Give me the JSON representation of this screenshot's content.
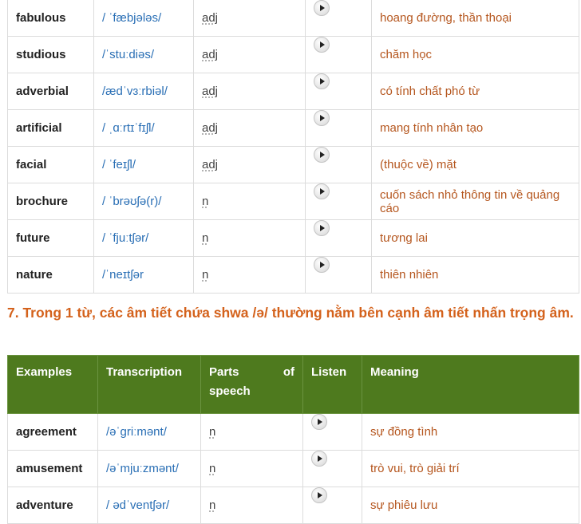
{
  "table1": {
    "rows": [
      {
        "word": "fabulous",
        "transcription": "/ ˈfæbjələs/",
        "pos": "adj",
        "meaning": "hoang đường, thần thoại"
      },
      {
        "word": "studious",
        "transcription": "/ˈstuːdiəs/",
        "pos": "adj",
        "meaning": "chăm học"
      },
      {
        "word": "adverbial",
        "transcription": "/ædˈvɜːrbiəl/",
        "pos": "adj",
        "meaning": "có tính chất phó từ"
      },
      {
        "word": "artificial",
        "transcription": "/ ˌɑːrtɪˈfɪʃl/",
        "pos": "adj",
        "meaning": "mang tính nhân tạo"
      },
      {
        "word": "facial",
        "transcription": "/ ˈfeɪʃl/",
        "pos": "adj",
        "meaning": "(thuộc về) mặt"
      },
      {
        "word": "brochure",
        "transcription": "/ ˈbrəʊʃə(r)/",
        "pos": "n",
        "meaning": "cuốn sách nhỏ thông tin về quảng cáo"
      },
      {
        "word": "future",
        "transcription": "/ ˈfjuːtʃər/",
        "pos": "n",
        "meaning": "tương lai"
      },
      {
        "word": "nature",
        "transcription": "/ˈneɪtʃər",
        "pos": "n",
        "meaning": "thiên nhiên"
      }
    ]
  },
  "section7": {
    "heading": "7. Trong 1 từ, các âm tiết chứa shwa /ə/ thường nằm bên cạnh âm tiết nhấn trọng âm."
  },
  "table2": {
    "headers": {
      "examples": "Examples",
      "transcription": "Transcription",
      "parts_1": "Parts",
      "parts_2": "of",
      "parts_3": "speech",
      "listen": "Listen",
      "meaning": "Meaning"
    },
    "rows": [
      {
        "word": "agreement",
        "transcription": "/əˈgriːmənt/",
        "pos": "n",
        "meaning": "sự đồng tình"
      },
      {
        "word": "amusement",
        "transcription": "/əˈmjuːzmənt/",
        "pos": "n",
        "meaning": "trò vui, trò giải trí"
      },
      {
        "word": "adventure",
        "transcription": "/ ədˈventʃər/",
        "pos": "n",
        "meaning": "sự phiêu lưu"
      }
    ]
  },
  "icons": {
    "listen": "play-button-icon"
  },
  "colors": {
    "header_bg": "#4e7a1e",
    "heading": "#d4621c",
    "transcription": "#2a6fb5",
    "meaning": "#b5561e"
  }
}
